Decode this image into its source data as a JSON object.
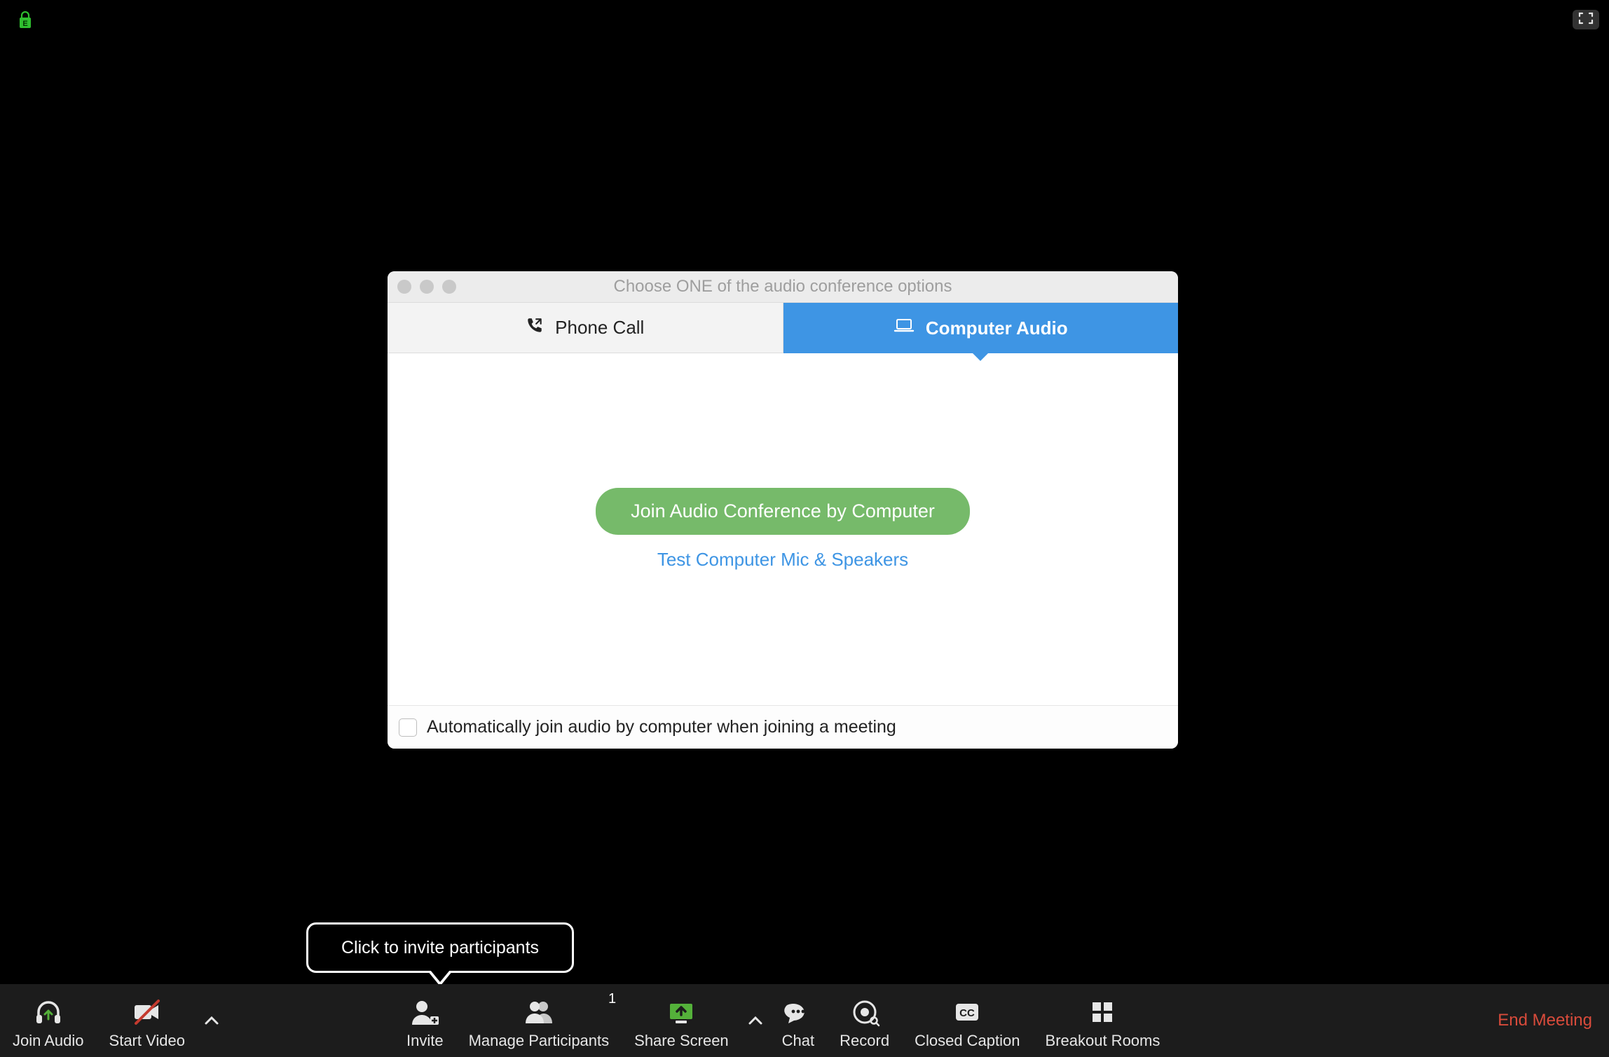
{
  "top": {
    "encryption_badge_letter": "E"
  },
  "dialog": {
    "title": "Choose ONE of the audio conference options",
    "tabs": {
      "phone": "Phone Call",
      "computer": "Computer Audio"
    },
    "join_button": "Join Audio Conference by Computer",
    "test_link": "Test Computer Mic & Speakers",
    "auto_join_label": "Automatically join audio by computer when joining a meeting",
    "auto_join_checked": false,
    "active_tab": "computer"
  },
  "tooltip": {
    "invite": "Click to invite participants"
  },
  "toolbar": {
    "join_audio": "Join Audio",
    "start_video": "Start Video",
    "invite": "Invite",
    "manage_participants": "Manage Participants",
    "participants_count": "1",
    "share_screen": "Share Screen",
    "chat": "Chat",
    "record": "Record",
    "closed_caption": "Closed Caption",
    "closed_caption_badge": "CC",
    "breakout_rooms": "Breakout Rooms",
    "end_meeting": "End Meeting"
  },
  "colors": {
    "accent_blue": "#3e95e4",
    "accent_green": "#76ba6a",
    "share_green": "#54b13a",
    "end_red": "#d94b3b"
  }
}
